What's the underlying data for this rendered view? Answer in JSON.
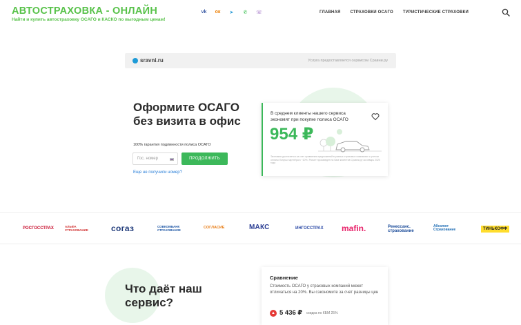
{
  "header": {
    "title": "АВТОСТРАХОВКА - ОНЛАЙН",
    "tagline": "Найти и купить автостраховку ОСАГО и КАСКО по выгодным ценам!",
    "socials": [
      {
        "icon": "vk-icon",
        "glyph": "vk"
      },
      {
        "icon": "odnoklassniki-icon",
        "glyph": "ок"
      },
      {
        "icon": "telegram-icon",
        "glyph": "➤"
      },
      {
        "icon": "whatsapp-icon",
        "glyph": "✆"
      },
      {
        "icon": "viber-icon",
        "glyph": "☏"
      }
    ],
    "nav": [
      "ГЛАВНАЯ",
      "СТРАХОВКИ ОСАГО",
      "ТУРИСТИЧЕСКИЕ СТРАХОВКИ"
    ],
    "search_icon": "search-icon"
  },
  "sravni": {
    "logo_text": "sravni.ru",
    "note": "Услуга предоставляется сервисом Сравни.ру"
  },
  "hero": {
    "title": "Оформите ОСАГО без визита в офис",
    "subtitle": "100% гарантия подлинности полиса ОСАГО",
    "plate_placeholder": "Гос. номер",
    "submit_label": "ПРОДОЛЖИТЬ",
    "no_number_link": "Еще не получили номер?"
  },
  "savings_card": {
    "text": "В среднем клиенты нашего сервиса экономят при покупке полиса ОСАГО",
    "amount": "954 ₽",
    "footnote": "Экономия достигается за счет сравнения предложений в разных страховых компаниях с учетом оплаты бонусы партнёра в ~20%. Расчет произведен по базе клиентов Сравни.ру за январь 2020 года"
  },
  "insurers": [
    {
      "name": "РОСГОССТРАХ"
    },
    {
      "name": "АЛЬФА СТРАХОВАНИЕ"
    },
    {
      "name": "согаз"
    },
    {
      "name": "СОВКОМБАНК СТРАХОВАНИЕ"
    },
    {
      "name": "СОГЛАСИЕ"
    },
    {
      "name": "МАКС"
    },
    {
      "name": "ИНГОССТРАХ"
    },
    {
      "name": "mafin."
    },
    {
      "name": "Ренессанс. страхование"
    },
    {
      "name": "Абсолют Страхование"
    },
    {
      "name": "ТИНЬКОФФ"
    }
  ],
  "bottom": {
    "title": "Что даёт наш сервис?",
    "card_title": "Сравнение",
    "card_text": "Стоимость ОСАГО у страховых компаний может отличаться на 20%. Вы сэкономите за счет разницы цен",
    "price": "5 436 ₽",
    "discount": "скидка по КБМ 25%"
  },
  "colors": {
    "brand_green": "#58c24a",
    "button_green": "#3cb85a",
    "link_blue": "#2a7fd8"
  }
}
